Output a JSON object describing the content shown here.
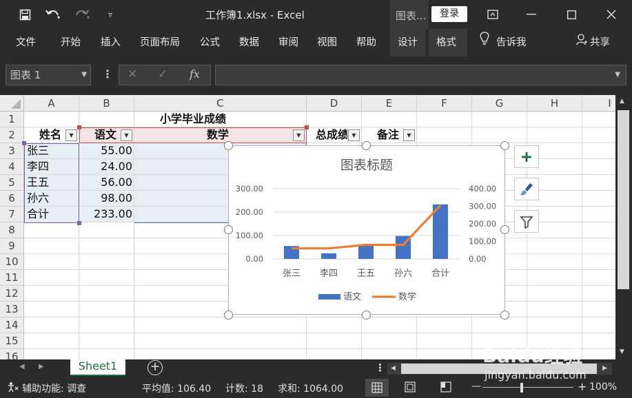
{
  "window": {
    "doc_title": "工作簿1.xlsx  -  Excel",
    "chart_tools_label": "图表...",
    "login_label": "登录"
  },
  "ribbon": {
    "tabs": [
      "文件",
      "开始",
      "插入",
      "页面布局",
      "公式",
      "数据",
      "审阅",
      "视图",
      "帮助",
      "设计",
      "格式"
    ],
    "tell_me": "告诉我",
    "share": "共享"
  },
  "formula_bar": {
    "name_box": "图表 1",
    "cancel_icon": "✕",
    "enter_icon": "✓",
    "fx_label": "fx",
    "value": ""
  },
  "grid": {
    "columns": [
      "A",
      "B",
      "C",
      "D",
      "E",
      "F",
      "G",
      "H",
      "I"
    ],
    "rows": [
      "1",
      "2",
      "3",
      "4",
      "5",
      "6",
      "7",
      "8",
      "9",
      "10",
      "11",
      "12",
      "13",
      "14",
      "15",
      "16"
    ],
    "title": "小学毕业成绩",
    "headers": {
      "name": "姓名",
      "chinese": "语文",
      "math": "数学",
      "total": "总成绩",
      "note": "备注"
    },
    "data": [
      {
        "name": "张三",
        "chinese": "55.00"
      },
      {
        "name": "李四",
        "chinese": "24.00"
      },
      {
        "name": "王五",
        "chinese": "56.00"
      },
      {
        "name": "孙六",
        "chinese": "98.00"
      },
      {
        "name": "合计",
        "chinese": "233.00"
      }
    ]
  },
  "chart_data": {
    "type": "bar",
    "title": "图表标题",
    "categories": [
      "张三",
      "李四",
      "王五",
      "孙六",
      "合计"
    ],
    "series": [
      {
        "name": "语文",
        "type": "bar",
        "axis": "left",
        "color": "#4472c4",
        "values": [
          55,
          24,
          56,
          98,
          233
        ]
      },
      {
        "name": "数学",
        "type": "line",
        "axis": "right",
        "color": "#ed7d31",
        "values": [
          60,
          60,
          80,
          80,
          305
        ]
      }
    ],
    "ylim": [
      0,
      300
    ],
    "y2lim": [
      0,
      400
    ],
    "y_ticks": [
      "0.00",
      "100.00",
      "200.00",
      "300.00"
    ],
    "y2_ticks": [
      "0.00",
      "100.00",
      "200.00",
      "300.00",
      "400.00"
    ],
    "legend": "bottom",
    "grid": true
  },
  "chart_side_buttons": [
    "plus-icon",
    "brush-icon",
    "filter-icon"
  ],
  "sheet_tabs": {
    "active": "Sheet1",
    "add_label": "+"
  },
  "statusbar": {
    "accessibility": "辅助功能: 调查",
    "average": "平均值: 106.40",
    "count": "计数: 18",
    "sum": "求和: 1064.00",
    "zoom": "100%"
  },
  "watermark": {
    "brand": "Baidu经验",
    "url": "jingyan.baidu.com"
  },
  "colors": {
    "accent": "#1e7145",
    "bar": "#4472c4",
    "line": "#ed7d31",
    "selection": "#e8eef8"
  }
}
